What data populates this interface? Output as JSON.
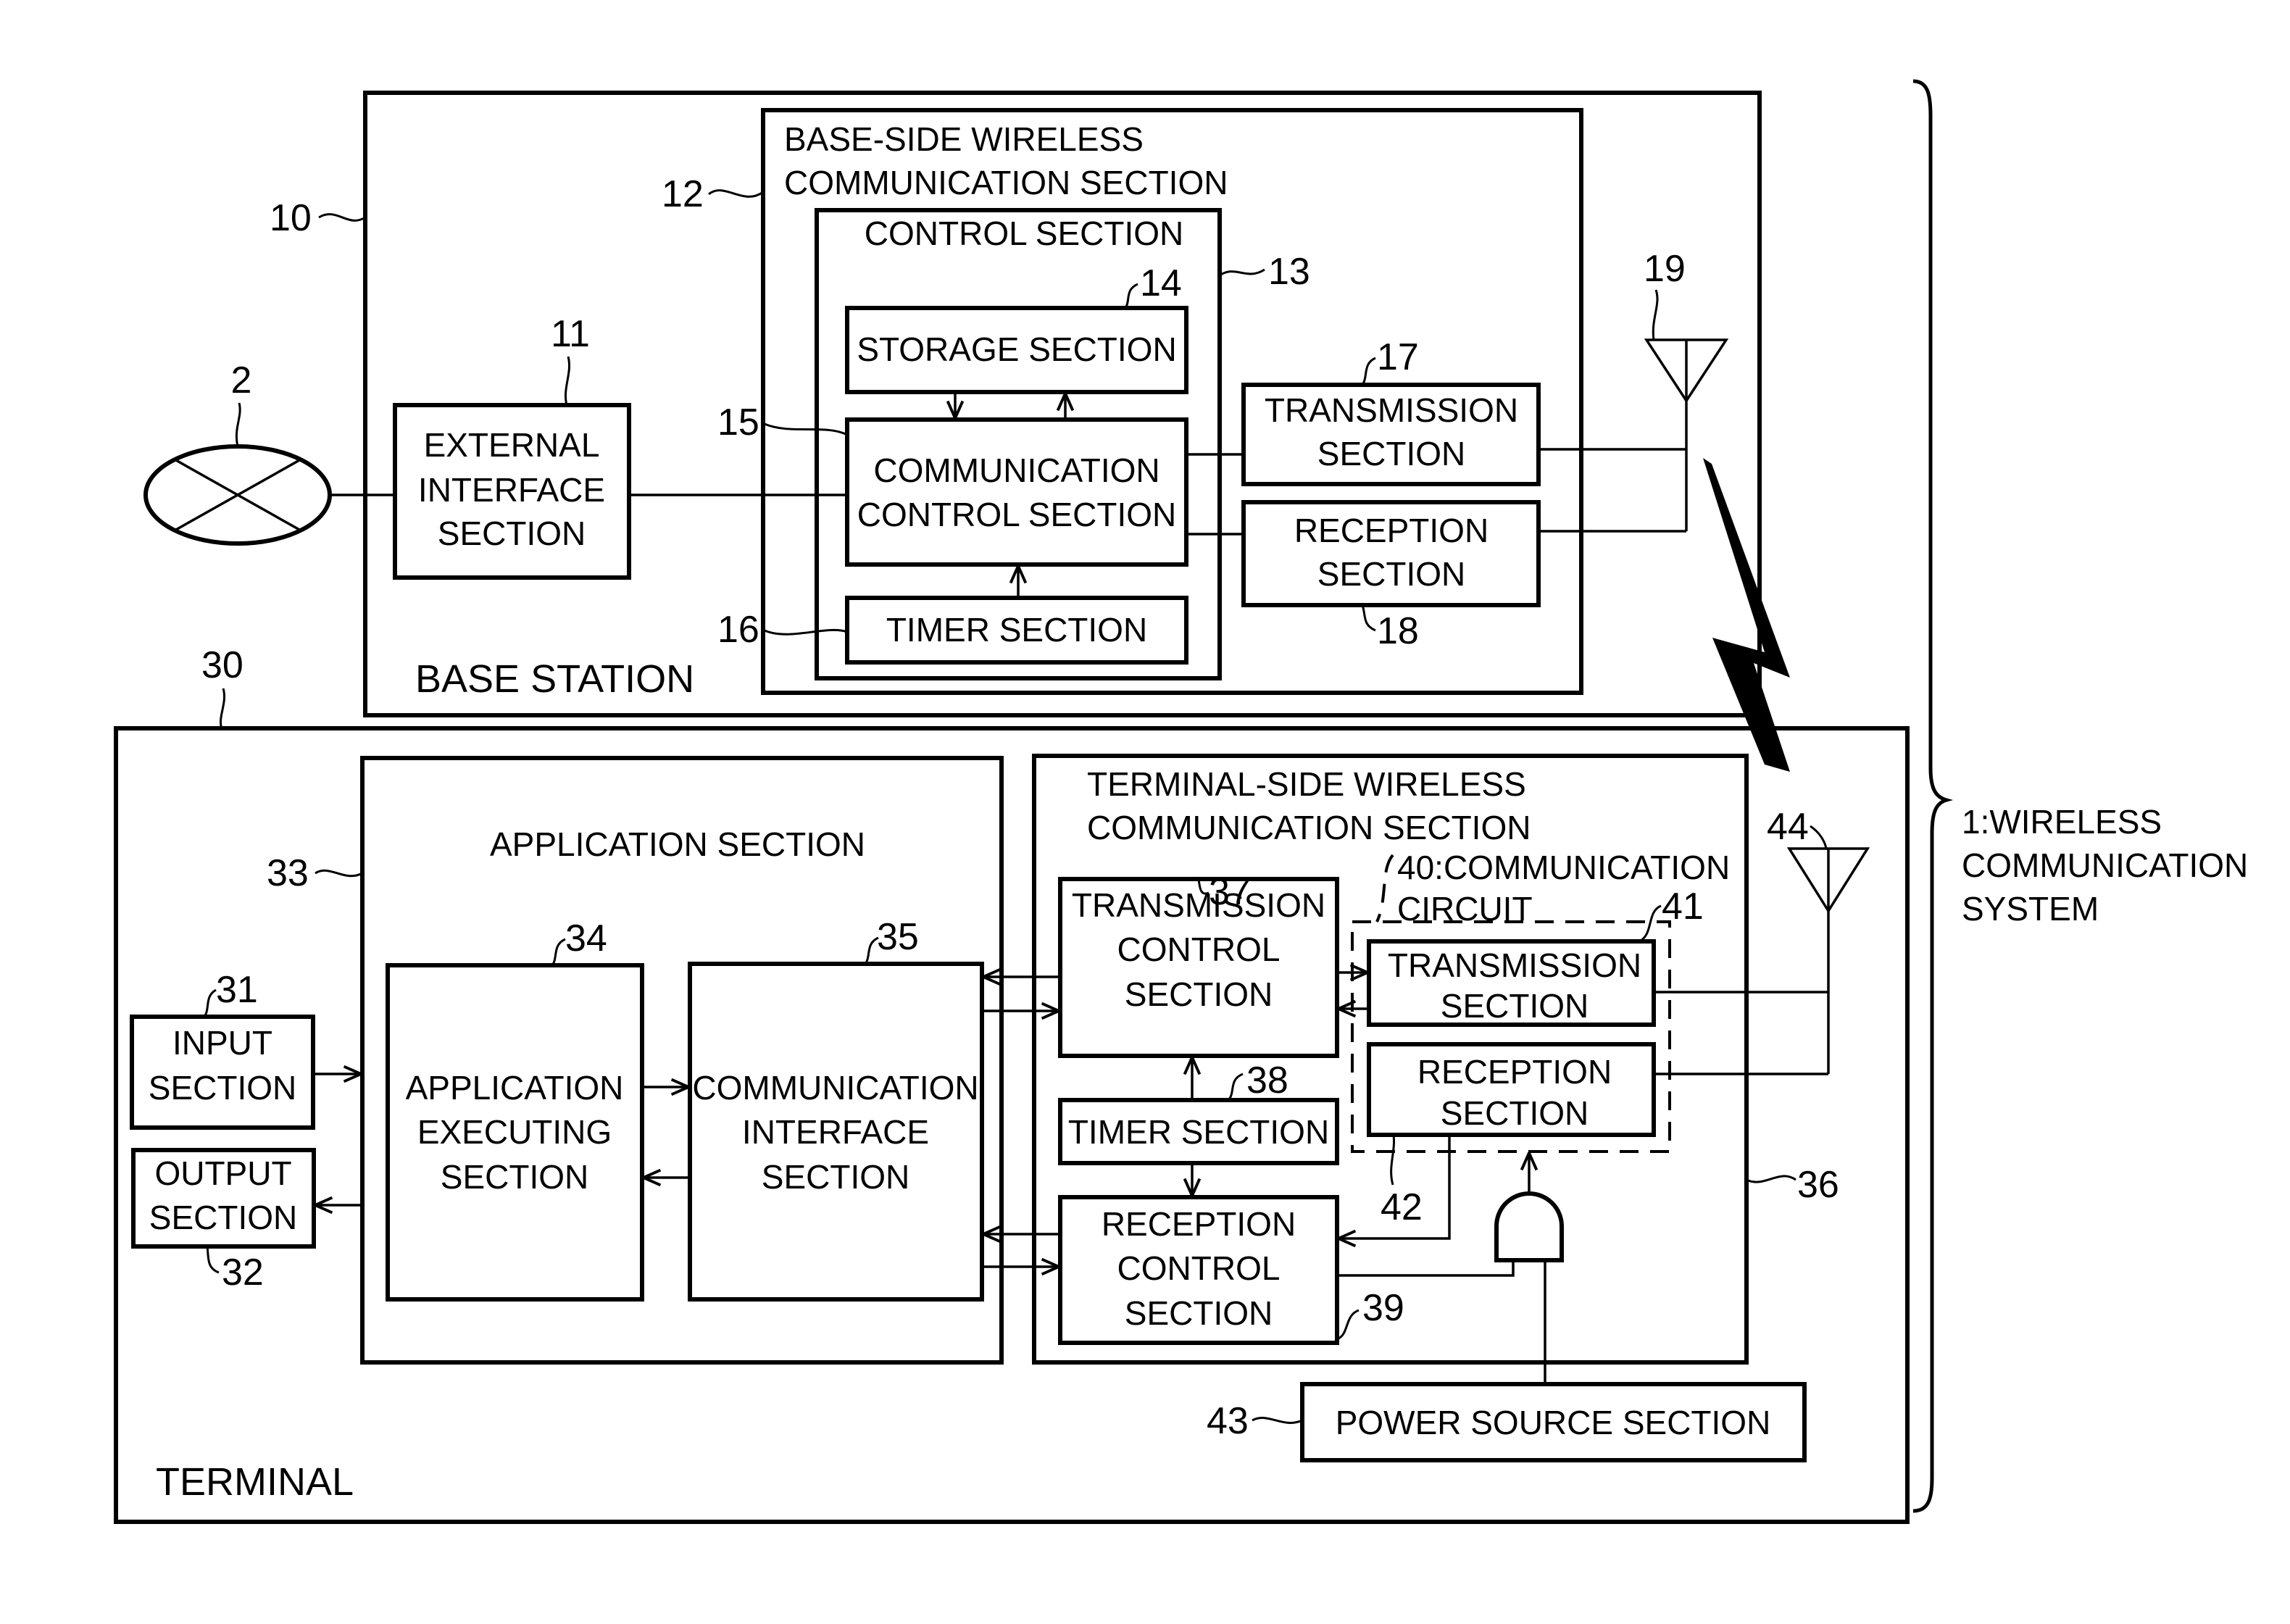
{
  "system": {
    "ref": "1:WIRELESS",
    "lines": [
      "1:WIRELESS",
      "COMMUNICATION",
      "SYSTEM"
    ]
  },
  "network": {
    "ref": "2"
  },
  "base_station": {
    "ref": "10",
    "title": "BASE STATION",
    "external_interface": {
      "ref": "11",
      "lines": [
        "EXTERNAL",
        "INTERFACE",
        "SECTION"
      ]
    },
    "wireless_section": {
      "ref": "12",
      "lines": [
        "BASE-SIDE WIRELESS",
        "COMMUNICATION SECTION"
      ],
      "control_section": {
        "ref": "13",
        "title": "CONTROL SECTION",
        "storage": {
          "ref": "14",
          "label": "STORAGE SECTION"
        },
        "comm_control": {
          "ref": "15",
          "lines": [
            "COMMUNICATION",
            "CONTROL SECTION"
          ]
        },
        "timer": {
          "ref": "16",
          "label": "TIMER SECTION"
        }
      },
      "transmission": {
        "ref": "17",
        "lines": [
          "TRANSMISSION",
          "SECTION"
        ]
      },
      "reception": {
        "ref": "18",
        "lines": [
          "RECEPTION",
          "SECTION"
        ]
      }
    },
    "antenna": {
      "ref": "19"
    }
  },
  "terminal": {
    "ref": "30",
    "title": "TERMINAL",
    "input": {
      "ref": "31",
      "lines": [
        "INPUT",
        "SECTION"
      ]
    },
    "output": {
      "ref": "32",
      "lines": [
        "OUTPUT",
        "SECTION"
      ]
    },
    "application_section": {
      "ref": "33",
      "title": "APPLICATION SECTION",
      "executing": {
        "ref": "34",
        "lines": [
          "APPLICATION",
          "EXECUTING",
          "SECTION"
        ]
      },
      "comm_interface": {
        "ref": "35",
        "lines": [
          "COMMUNICATION",
          "INTERFACE",
          "SECTION"
        ]
      }
    },
    "wireless_section": {
      "ref": "36",
      "lines": [
        "TERMINAL-SIDE WIRELESS",
        "COMMUNICATION SECTION"
      ],
      "transmission_control": {
        "ref": "37",
        "lines": [
          "TRANSMISSION",
          "CONTROL",
          "SECTION"
        ]
      },
      "timer": {
        "ref": "38",
        "label": "TIMER SECTION"
      },
      "reception_control": {
        "ref": "39",
        "lines": [
          "RECEPTION",
          "CONTROL",
          "SECTION"
        ]
      },
      "comm_circuit": {
        "lines": [
          "40:COMMUNICATION",
          "CIRCUIT"
        ],
        "transmission": {
          "ref": "41",
          "lines": [
            "TRANSMISSION",
            "SECTION"
          ]
        },
        "reception": {
          "ref": "42",
          "lines": [
            "RECEPTION",
            "SECTION"
          ]
        }
      }
    },
    "power_source": {
      "ref": "43",
      "label": "POWER SOURCE SECTION"
    },
    "antenna": {
      "ref": "44"
    }
  }
}
